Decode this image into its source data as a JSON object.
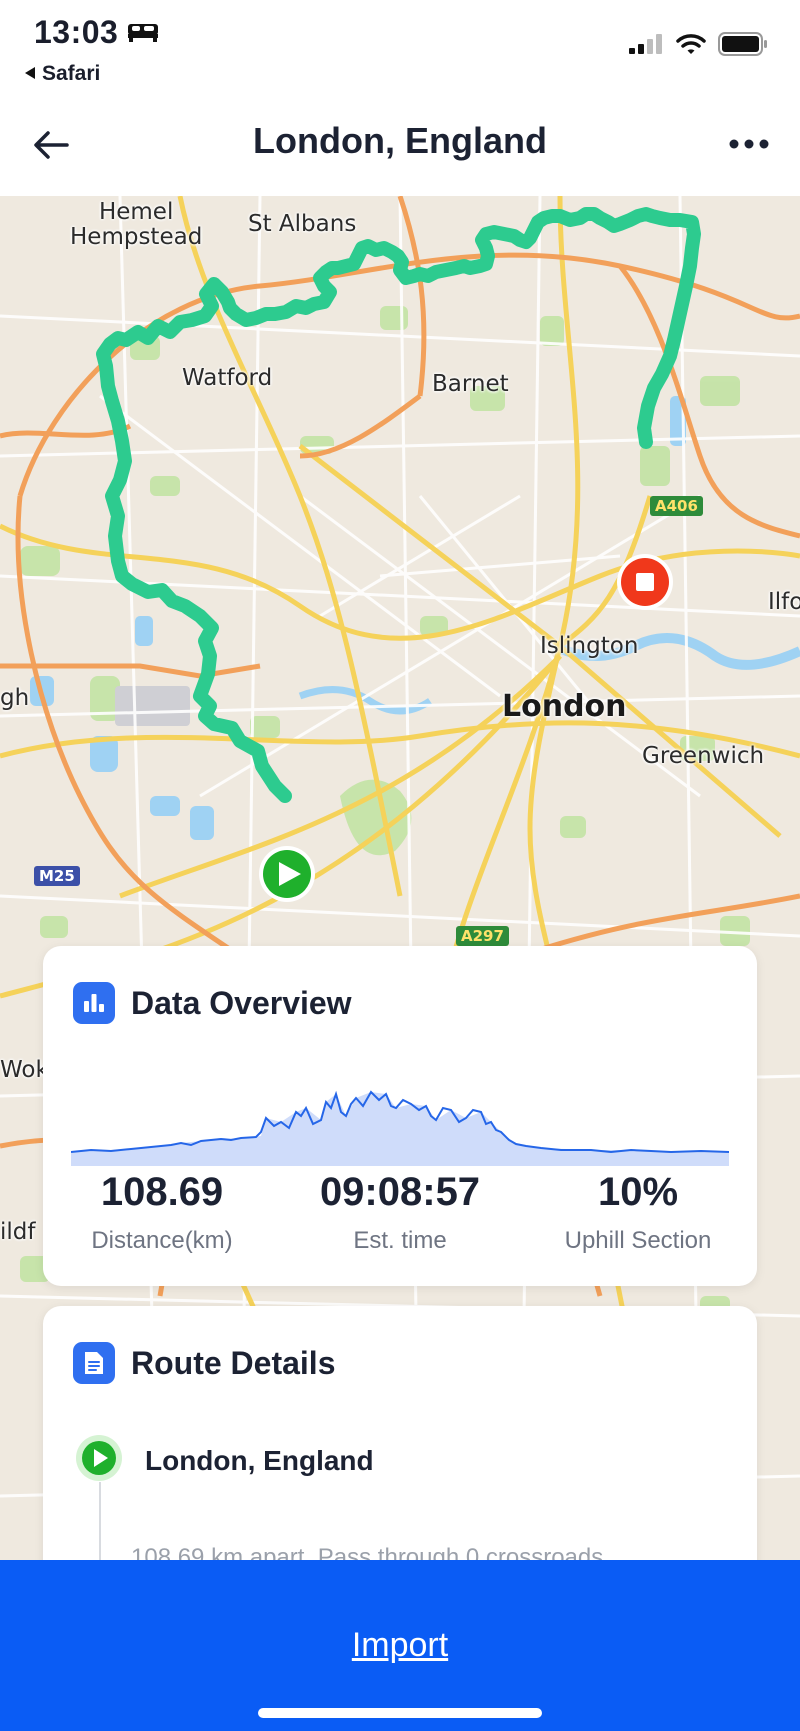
{
  "status_bar": {
    "time": "13:03",
    "back_app": "Safari",
    "icons": [
      "bed-icon",
      "signal-icon",
      "wifi-icon",
      "battery-icon"
    ]
  },
  "nav": {
    "title": "London, England",
    "icons": [
      "back-arrow-icon",
      "more-icon"
    ]
  },
  "map": {
    "places": {
      "hemel": "Hemel\nHempstead",
      "st_albans": "St Albans",
      "watford": "Watford",
      "barnet": "Barnet",
      "islington": "Islington",
      "london": "London",
      "greenwich": "Greenwich",
      "ilford": "Ilfo",
      "slough": "gh",
      "woking": "Wok",
      "guildford": "ildf"
    },
    "roads": {
      "m25": "M25",
      "a297": "A297",
      "a406": "A406"
    },
    "route_color": "#2dcb8f",
    "start_marker": "play-icon",
    "end_marker": "stop-icon"
  },
  "overview": {
    "title": "Data Overview",
    "icon": "bar-chart-icon",
    "chart_color": "#2566e8",
    "stats": [
      {
        "value": "108.69",
        "label": "Distance(km)"
      },
      {
        "value": "09:08:57",
        "label": "Est. time"
      },
      {
        "value": "10%",
        "label": "Uphill Section"
      }
    ]
  },
  "route": {
    "title": "Route Details",
    "icon": "document-icon",
    "start_name": "London, England",
    "description": "108.69 km apart. Pass through 0 crossroads"
  },
  "import_bar": {
    "label": "Import",
    "color": "#0a5cf5"
  }
}
